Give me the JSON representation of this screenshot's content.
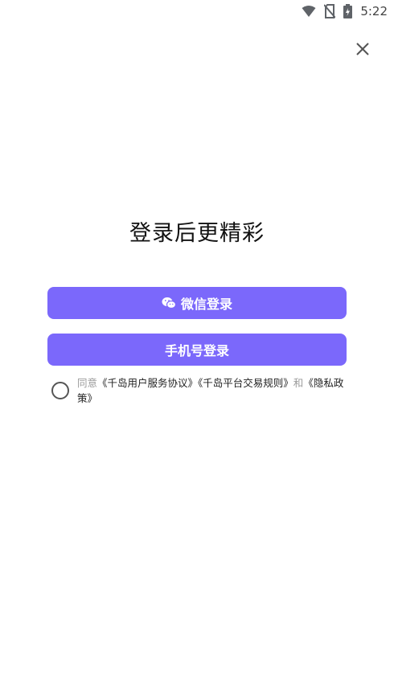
{
  "status_bar": {
    "time": "5:22",
    "icons": [
      "wifi-icon",
      "no-sim-icon",
      "battery-charging-icon"
    ]
  },
  "close_icon": "close-icon",
  "title": "登录后更精彩",
  "buttons": {
    "wechat_label": "微信登录",
    "wechat_icon": "wechat-icon",
    "phone_label": "手机号登录"
  },
  "agreement": {
    "prefix": "同意",
    "user_service": "《千岛用户服务协议》",
    "trade_rules": "《千岛平台交易规则》",
    "conjunction": "和",
    "privacy": "《隐私政策》",
    "checked": false
  },
  "colors": {
    "accent": "#7b68fb",
    "muted_text": "#9a9a9a"
  }
}
